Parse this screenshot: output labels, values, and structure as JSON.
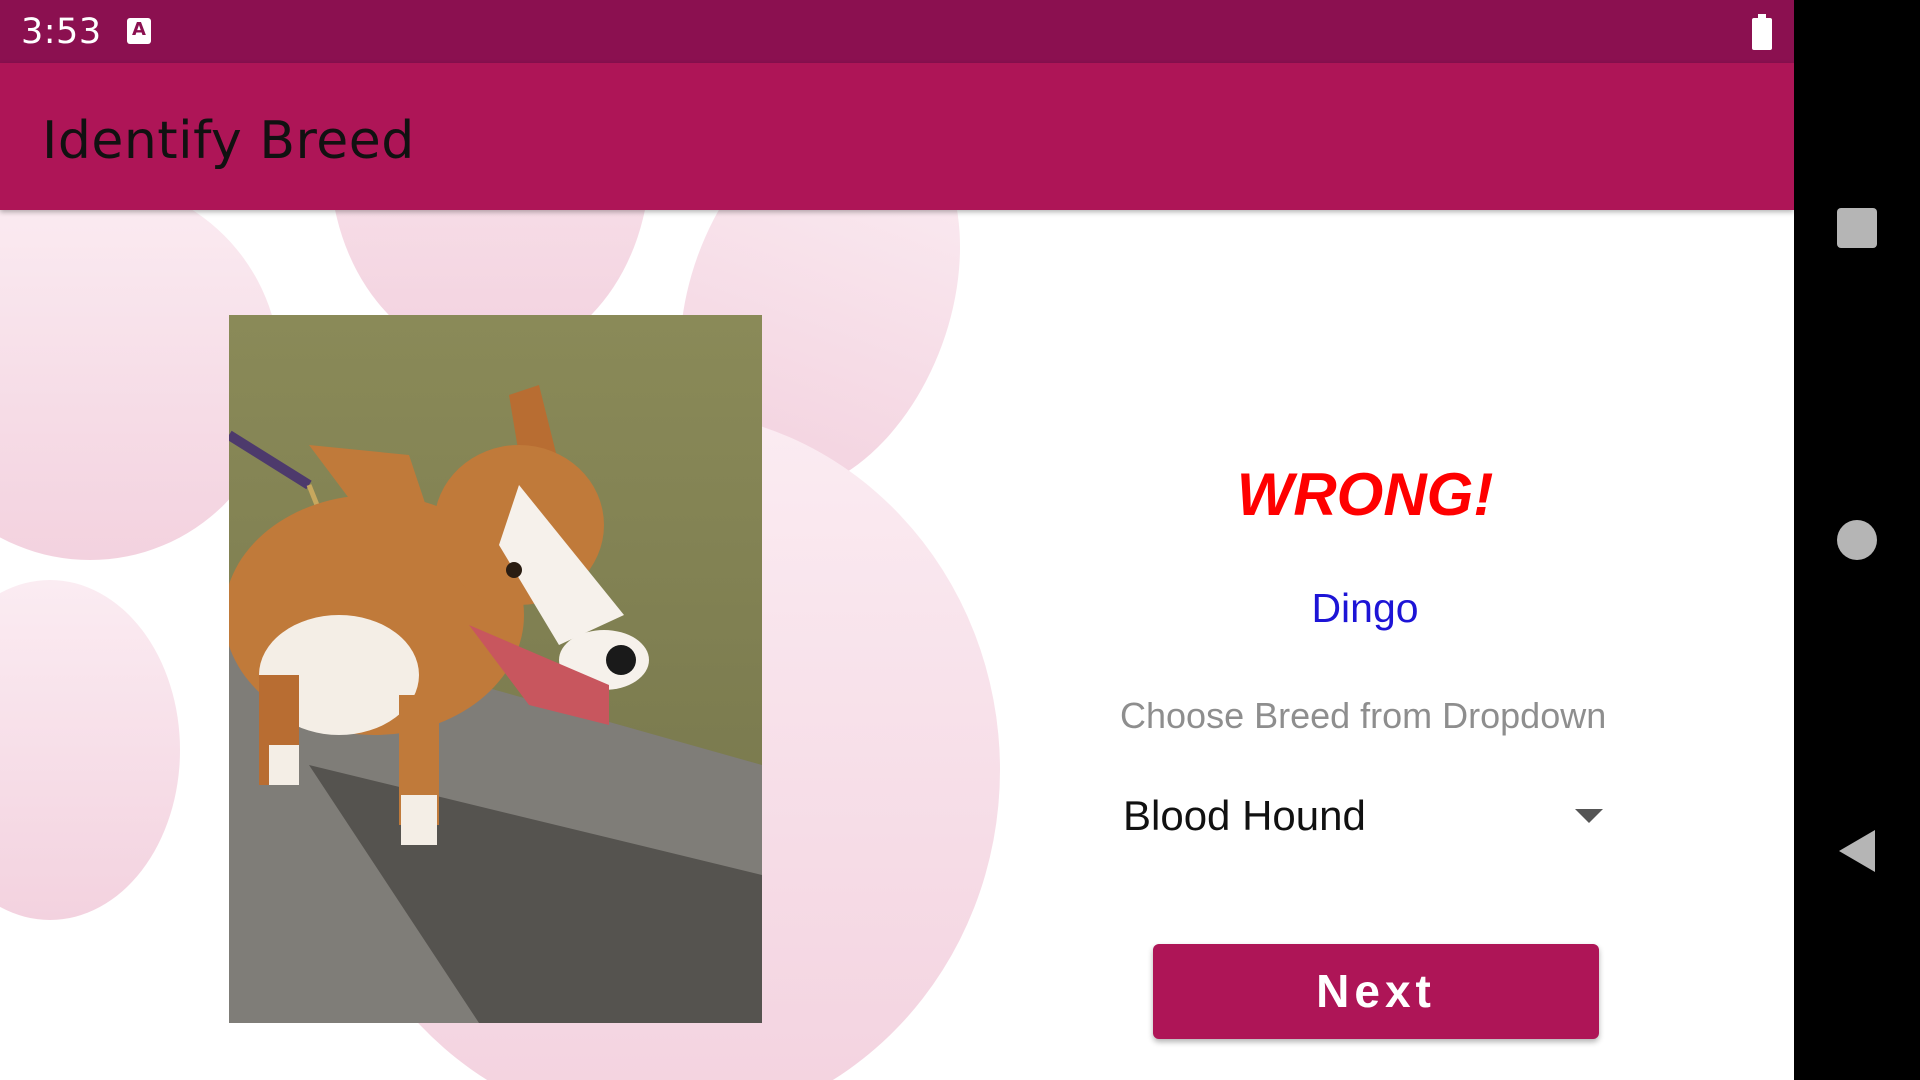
{
  "status_bar": {
    "time": "3:53",
    "notification_icon": "a-icon",
    "battery_icon": "battery-full-icon"
  },
  "app_bar": {
    "title": "Identify Breed"
  },
  "quiz": {
    "image": "dog-photo",
    "result": "WRONG!",
    "correct_answer": "Dingo",
    "prompt": "Choose Breed from Dropdown",
    "selected_breed": "Blood Hound",
    "next_label": "Next"
  },
  "nav_bar": {
    "recents_icon": "square-icon",
    "home_icon": "circle-icon",
    "back_icon": "back-triangle-icon"
  },
  "colors": {
    "status_bar": "#8b1050",
    "primary": "#ae1557",
    "result_text": "#ff0000",
    "answer_text": "#1d14d6",
    "prompt_text": "#8e8e8e",
    "nav_bar": "#000000"
  }
}
